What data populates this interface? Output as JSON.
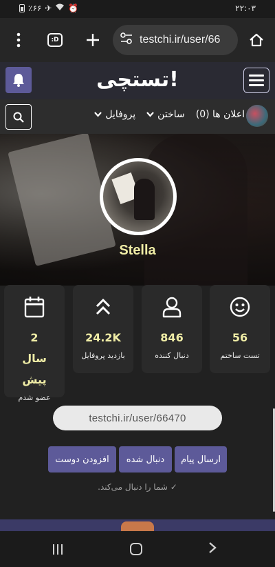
{
  "status_bar": {
    "time": "۲۲:۰۳",
    "battery": "٪۶۶"
  },
  "browser": {
    "url": "testchi.ir/user/66",
    "tabs_icon_label": ":D"
  },
  "site": {
    "logo": "تستچی!"
  },
  "nav": {
    "items": [
      {
        "label": "پروفایل"
      },
      {
        "label": "ساختن"
      },
      {
        "label": "اعلان ها (0)"
      }
    ]
  },
  "profile": {
    "username": "Stella"
  },
  "stats": [
    {
      "value": "56",
      "label": "تست ساختم",
      "icon": "smile-icon"
    },
    {
      "value": "846",
      "label": "دنبال کننده",
      "icon": "user-icon"
    },
    {
      "value": "24.2K",
      "label": "بازدید پروفایل",
      "icon": "double-chevron-up-icon"
    },
    {
      "value": "2 سال پیش",
      "label": "عضو شدم",
      "icon": "calendar-icon"
    }
  ],
  "profile_url": "testchi.ir/user/66470",
  "actions": {
    "send_message": "ارسال پیام",
    "followed": "دنبال شده",
    "add_friend": "افزودن دوست"
  },
  "follows_you_note": "شما را دنبال می‌کند."
}
